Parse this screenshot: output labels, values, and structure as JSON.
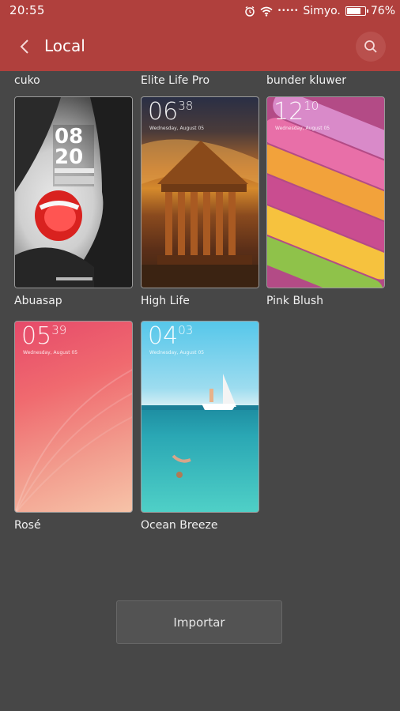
{
  "status_bar": {
    "time": "20:55",
    "signal": "•••••",
    "carrier": "Simyo.",
    "battery_percent": "76%",
    "battery_level": 0.76
  },
  "header": {
    "title": "Local"
  },
  "top_row_labels": [
    "cuko",
    "Elite Life Pro",
    "bunder kluwer"
  ],
  "themes": [
    {
      "name": "Abuasap"
    },
    {
      "name": "High Life",
      "clock_h": "06",
      "clock_m": "38",
      "date": "Wednesday, August 05"
    },
    {
      "name": "Pink Blush",
      "clock_h": "12",
      "clock_m": "10",
      "date": "Wednesday, August 05"
    },
    {
      "name": "Rosé",
      "clock_h": "05",
      "clock_m": "39",
      "date": "Wednesday, August 05"
    },
    {
      "name": "Ocean Breeze",
      "clock_h": "04",
      "clock_m": "03",
      "date": "Wednesday, August 05"
    }
  ],
  "import_button": {
    "label": "Importar"
  },
  "colors": {
    "accent": "#b0403d",
    "background": "#474747"
  }
}
